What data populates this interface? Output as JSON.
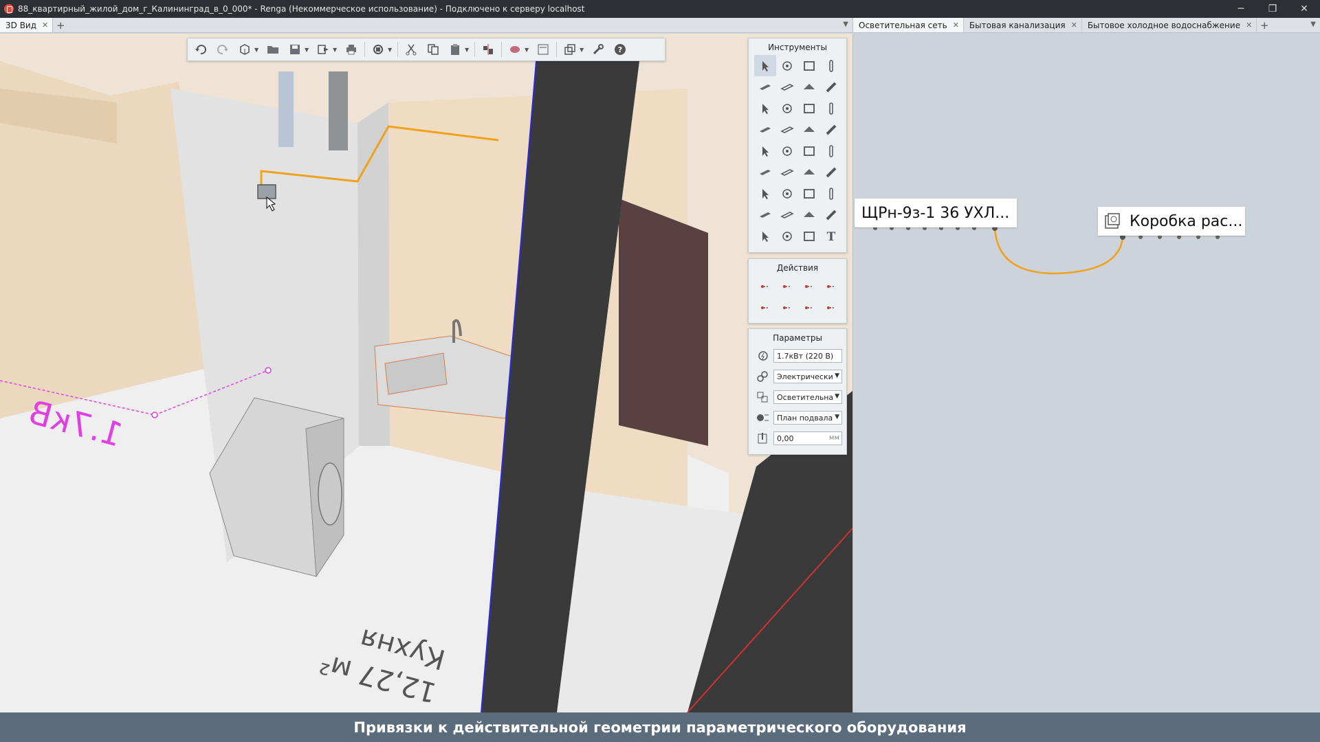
{
  "window": {
    "title": "88_квартирный_жилой_дом_г_Калининград_в_0_000* - Renga (Некоммерческое использование) - Подключено к серверу localhost",
    "minimize": "─",
    "restore": "❐",
    "close": "✕"
  },
  "left_tabs": [
    {
      "label": "3D Вид",
      "close": "✕"
    }
  ],
  "right_tabs": [
    {
      "label": "Осветительная сеть",
      "close": "✕"
    },
    {
      "label": "Бытовая канализация",
      "close": "✕"
    },
    {
      "label": "Бытовое холодное водоснабжение",
      "close": "✕"
    }
  ],
  "tab_add": "+",
  "tab_menu": "▼",
  "panels": {
    "tools_title": "Инструменты",
    "actions_title": "Действия",
    "params_title": "Параметры"
  },
  "params": {
    "power": "1.7кВт (220 В)",
    "system_type": "Электрически",
    "system": "Осветительна",
    "level": "План подвала",
    "offset": "0,00",
    "offset_unit": "мм"
  },
  "scene": {
    "power_label": "1.7кВ",
    "room_name": "Кухня",
    "room_area": "12,27 м²"
  },
  "schematic": {
    "node1_label": "ЩРн-9з-1 36 УХЛ...",
    "node2_label": "Коробка рас...",
    "wire_color": "#f0a21a"
  },
  "caption": "Привязки к действительной геометрии параметрического оборудования"
}
